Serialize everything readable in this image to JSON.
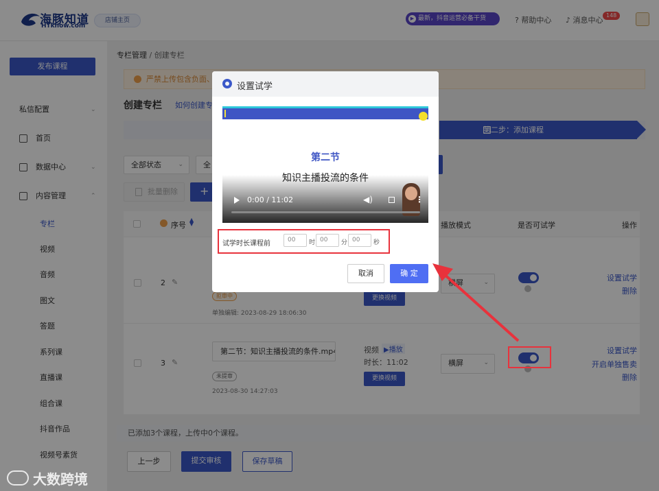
{
  "header": {
    "logo_text": "海豚知道",
    "logo_sub": "HTknow.com",
    "shop_btn": "店铺主页",
    "promo": "最新，抖音运营必备干货",
    "help": "帮助中心",
    "messages": "消息中心",
    "msg_count": "148"
  },
  "sidebar": {
    "publish": "发布课程",
    "items": [
      {
        "label": "私信配置"
      },
      {
        "label": "首页"
      },
      {
        "label": "数据中心"
      },
      {
        "label": "内容管理"
      }
    ],
    "sub": [
      "专栏",
      "视频",
      "音频",
      "图文",
      "答题",
      "系列课",
      "直播课",
      "组合课",
      "抖音作品",
      "视频号素货"
    ]
  },
  "breadcrumb": {
    "root": "专栏管理",
    "sep": "/",
    "current": "创建专栏"
  },
  "notice": "严禁上传包含负面、",
  "page": {
    "title": "创建专栏",
    "howto": "如何创建专"
  },
  "steps": {
    "step2": "第二步：添加课程"
  },
  "filters": {
    "status": "全部状态",
    "second": "全"
  },
  "actions": {
    "batch_delete": "批量删除",
    "add": "+"
  },
  "table": {
    "headers": {
      "seq": "序号",
      "play_mode": "播放模式",
      "trial": "是否可试学",
      "ops": "操作"
    },
    "rows": [
      {
        "seq": "2",
        "status": "拒审中",
        "updated": "单独编辑: 2023-08-29 18:06:30",
        "swap": "更换视频",
        "mode": "横屏",
        "ops": [
          "设置试学",
          "删除"
        ]
      },
      {
        "seq": "3",
        "name": "第二节：知识主播投流的条件.mp4",
        "status": "未提审",
        "created": "2023-08-30 14:27:03",
        "media_type": "视频",
        "play_tag": "▶播放",
        "duration": "时长：11:02",
        "swap": "更换视频",
        "mode": "横屏",
        "ops": [
          "设置试学",
          "开启单独售卖",
          "删除"
        ]
      }
    ]
  },
  "footer": {
    "summary": "已添加3个课程，上传中0个课程。",
    "prev": "上一步",
    "submit": "提交审核",
    "draft": "保存草稿"
  },
  "modal": {
    "title": "设置试学",
    "video_title": "第二节",
    "video_subtitle": "知识主播投流的条件",
    "video_time": "0:00 / 11:02",
    "trial_label": "试学时长课程前",
    "hour_ph": "00",
    "min_ph": "00",
    "sec_ph": "00",
    "hour_unit": "时",
    "min_unit": "分",
    "sec_unit": "秒",
    "cancel": "取消",
    "confirm": "确 定"
  },
  "watermark": "大数跨境",
  "colors": {
    "primary": "#3b58c9",
    "highlight": "#e8323c",
    "confirm": "#4f6ef3"
  }
}
